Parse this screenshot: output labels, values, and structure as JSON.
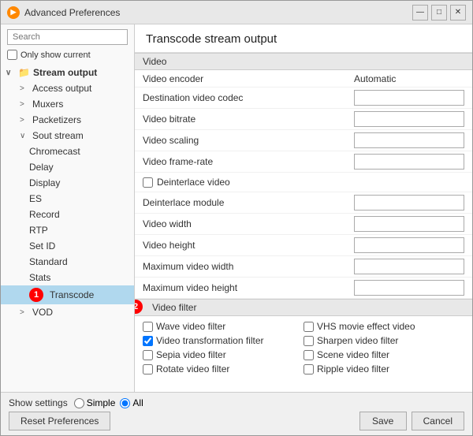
{
  "window": {
    "title": "Advanced Preferences",
    "icon": "▶"
  },
  "left": {
    "search_placeholder": "Search",
    "only_show_current": "Only show current",
    "tree": [
      {
        "id": "stream-output",
        "label": "Stream output",
        "level": 0,
        "expanded": true,
        "has_icon": true,
        "expander": "∨"
      },
      {
        "id": "access-output",
        "label": "Access output",
        "level": 1,
        "expander": ">"
      },
      {
        "id": "muxers",
        "label": "Muxers",
        "level": 1,
        "expander": ">"
      },
      {
        "id": "packetizers",
        "label": "Packetizers",
        "level": 1,
        "expander": ">"
      },
      {
        "id": "sout-stream",
        "label": "Sout stream",
        "level": 1,
        "expander": "∨",
        "expanded": true
      },
      {
        "id": "chromecast",
        "label": "Chromecast",
        "level": 2
      },
      {
        "id": "delay",
        "label": "Delay",
        "level": 2
      },
      {
        "id": "display",
        "label": "Display",
        "level": 2
      },
      {
        "id": "es",
        "label": "ES",
        "level": 2
      },
      {
        "id": "record",
        "label": "Record",
        "level": 2
      },
      {
        "id": "rtp",
        "label": "RTP",
        "level": 2
      },
      {
        "id": "set-id",
        "label": "Set ID",
        "level": 2
      },
      {
        "id": "standard",
        "label": "Standard",
        "level": 2
      },
      {
        "id": "stats",
        "label": "Stats",
        "level": 2
      },
      {
        "id": "transcode",
        "label": "Transcode",
        "level": 2,
        "selected": true
      },
      {
        "id": "vod",
        "label": "VOD",
        "level": 1,
        "expander": ">"
      }
    ]
  },
  "right": {
    "title": "Transcode stream output",
    "sections": [
      {
        "id": "video-section",
        "label": "Video",
        "rows": [
          {
            "id": "video-encoder",
            "label": "Video encoder",
            "value": "Automatic",
            "type": "text"
          },
          {
            "id": "dest-video-codec",
            "label": "Destination video codec",
            "value": "",
            "type": "text"
          },
          {
            "id": "video-bitrate",
            "label": "Video bitrate",
            "value": "",
            "type": "text"
          },
          {
            "id": "video-scaling",
            "label": "Video scaling",
            "value": "",
            "type": "text"
          },
          {
            "id": "video-framerate",
            "label": "Video frame-rate",
            "value": "",
            "type": "text"
          },
          {
            "id": "deinterlace-video",
            "label": "Deinterlace video",
            "value": "",
            "type": "checkbox"
          },
          {
            "id": "deinterlace-module",
            "label": "Deinterlace module",
            "value": "",
            "type": "text"
          },
          {
            "id": "video-width",
            "label": "Video width",
            "value": "",
            "type": "text"
          },
          {
            "id": "video-height",
            "label": "Video height",
            "value": "",
            "type": "text"
          },
          {
            "id": "max-video-width",
            "label": "Maximum video width",
            "value": "",
            "type": "text"
          },
          {
            "id": "max-video-height",
            "label": "Maximum video height",
            "value": "",
            "type": "text"
          }
        ]
      },
      {
        "id": "video-filter-section",
        "label": "Video filter",
        "filters": [
          {
            "id": "wave-filter",
            "label": "Wave video filter",
            "checked": false,
            "col": 0
          },
          {
            "id": "vhs-filter",
            "label": "VHS movie effect video",
            "checked": false,
            "col": 1
          },
          {
            "id": "transformation-filter",
            "label": "Video transformation filter",
            "checked": true,
            "col": 0
          },
          {
            "id": "sharpen-filter",
            "label": "Sharpen video filter",
            "checked": false,
            "col": 1
          },
          {
            "id": "sepia-filter",
            "label": "Sepia video filter",
            "checked": false,
            "col": 0
          },
          {
            "id": "scene-filter",
            "label": "Scene video filter",
            "checked": false,
            "col": 1
          },
          {
            "id": "rotate-filter",
            "label": "Rotate video filter",
            "checked": false,
            "col": 0
          },
          {
            "id": "ripple-filter",
            "label": "Ripple video filter",
            "checked": false,
            "col": 1
          }
        ]
      }
    ]
  },
  "bottom": {
    "show_settings_label": "Show settings",
    "simple_label": "Simple",
    "all_label": "All",
    "reset_label": "Reset Preferences",
    "save_label": "Save",
    "cancel_label": "Cancel"
  },
  "annotations": {
    "badge1": "1",
    "badge2": "2"
  }
}
